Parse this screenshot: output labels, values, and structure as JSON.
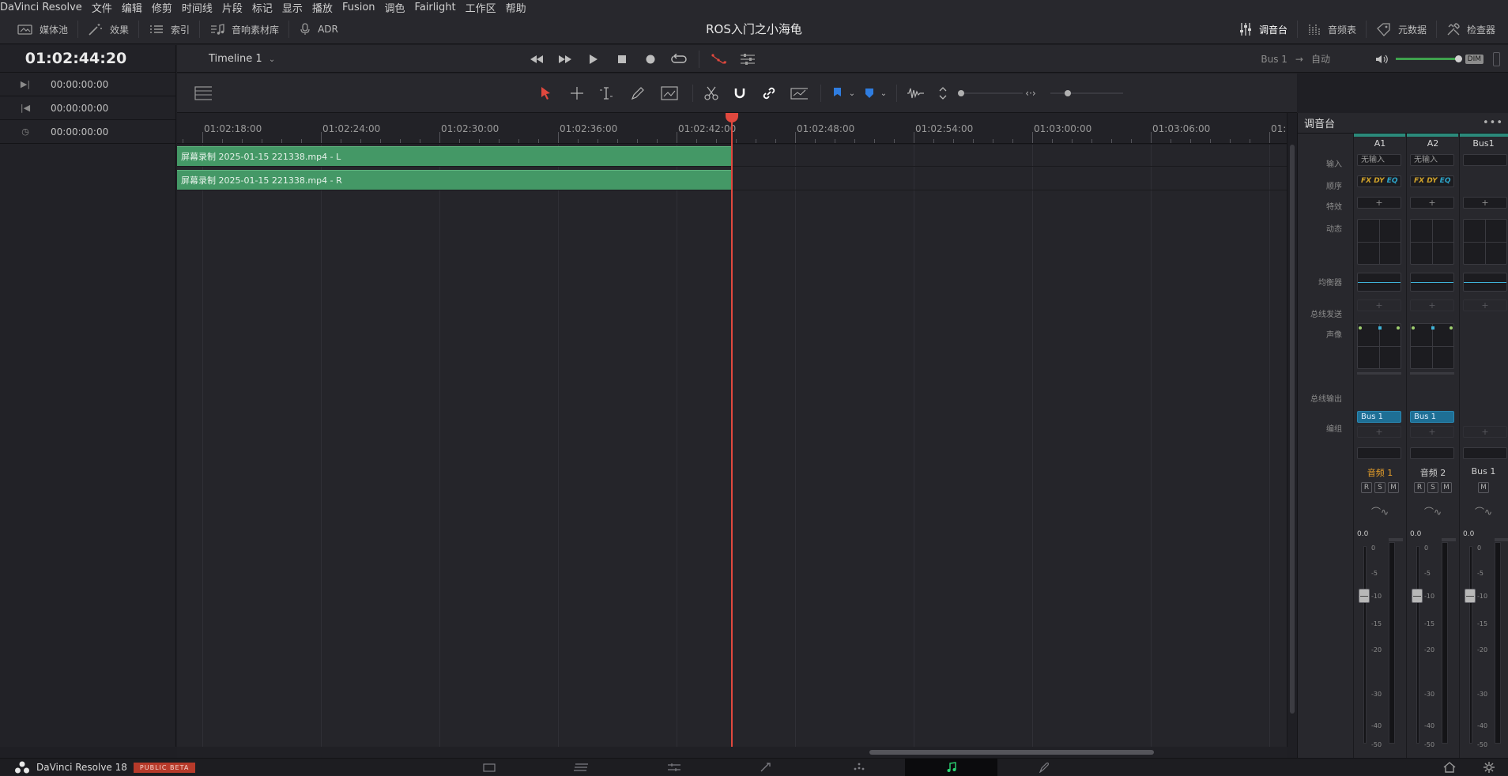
{
  "menu": [
    "DaVinci Resolve",
    "文件",
    "编辑",
    "修剪",
    "时间线",
    "片段",
    "标记",
    "显示",
    "播放",
    "Fusion",
    "调色",
    "Fairlight",
    "工作区",
    "帮助"
  ],
  "toolbar": {
    "media_pool": "媒体池",
    "effects": "效果",
    "index": "索引",
    "sound_library": "音响素材库",
    "adr": "ADR",
    "project_title": "ROS入门之小海龟",
    "mixer": "调音台",
    "meters": "音频表",
    "metadata": "元数据",
    "inspector": "检查器"
  },
  "timecodes": {
    "main": "01:02:44:20",
    "in": "00:00:00:00",
    "out": "00:00:00:00",
    "duration": "00:00:00:00"
  },
  "timeline": {
    "name": "Timeline 1",
    "bus": "Bus 1",
    "mode": "自动",
    "dim": "DIM",
    "ruler": [
      "01:02:18:00",
      "01:02:24:00",
      "01:02:30:00",
      "01:02:36:00",
      "01:02:42:00",
      "01:02:48:00",
      "01:02:54:00",
      "01:03:00:00",
      "01:03:06:00",
      "01:0"
    ],
    "clips": [
      "屏幕录制 2025-01-15 221338.mp4 - L",
      "屏幕录制 2025-01-15 221338.mp4 - R"
    ]
  },
  "mixer": {
    "title": "调音台",
    "row_labels": {
      "input": "输入",
      "order": "顺序",
      "effects": "特效",
      "dynamics": "动态",
      "eq": "均衡器",
      "bus_send": "总线发送",
      "pan": "声像",
      "bus_out": "总线输出",
      "group": "编组"
    },
    "strips": [
      {
        "header": "A1",
        "input": "无输入",
        "fx": [
          "FX",
          "DY",
          "EQ"
        ],
        "bus_out": "Bus 1",
        "name": "音频 1",
        "buttons": [
          "R",
          "S",
          "M"
        ],
        "level": "0.0"
      },
      {
        "header": "A2",
        "input": "无输入",
        "fx": [
          "FX",
          "DY",
          "EQ"
        ],
        "bus_out": "Bus 1",
        "name": "音频 2",
        "buttons": [
          "R",
          "S",
          "M"
        ],
        "level": "0.0"
      },
      {
        "header": "Bus1",
        "input": "",
        "name": "Bus 1",
        "buttons": [
          "M"
        ],
        "level": "0.0"
      }
    ],
    "plus": "+",
    "scale": [
      "0",
      "-5",
      "-10",
      "-15",
      "-20",
      "-30",
      "-40",
      "-50"
    ]
  },
  "bottom": {
    "app": "DaVinci Resolve 18",
    "beta": "PUBLIC BETA"
  },
  "colors": {
    "clip": "#449866",
    "playhead": "#e0483e",
    "accent_green": "#2bd673",
    "bus_blue": "#1e6f95"
  }
}
